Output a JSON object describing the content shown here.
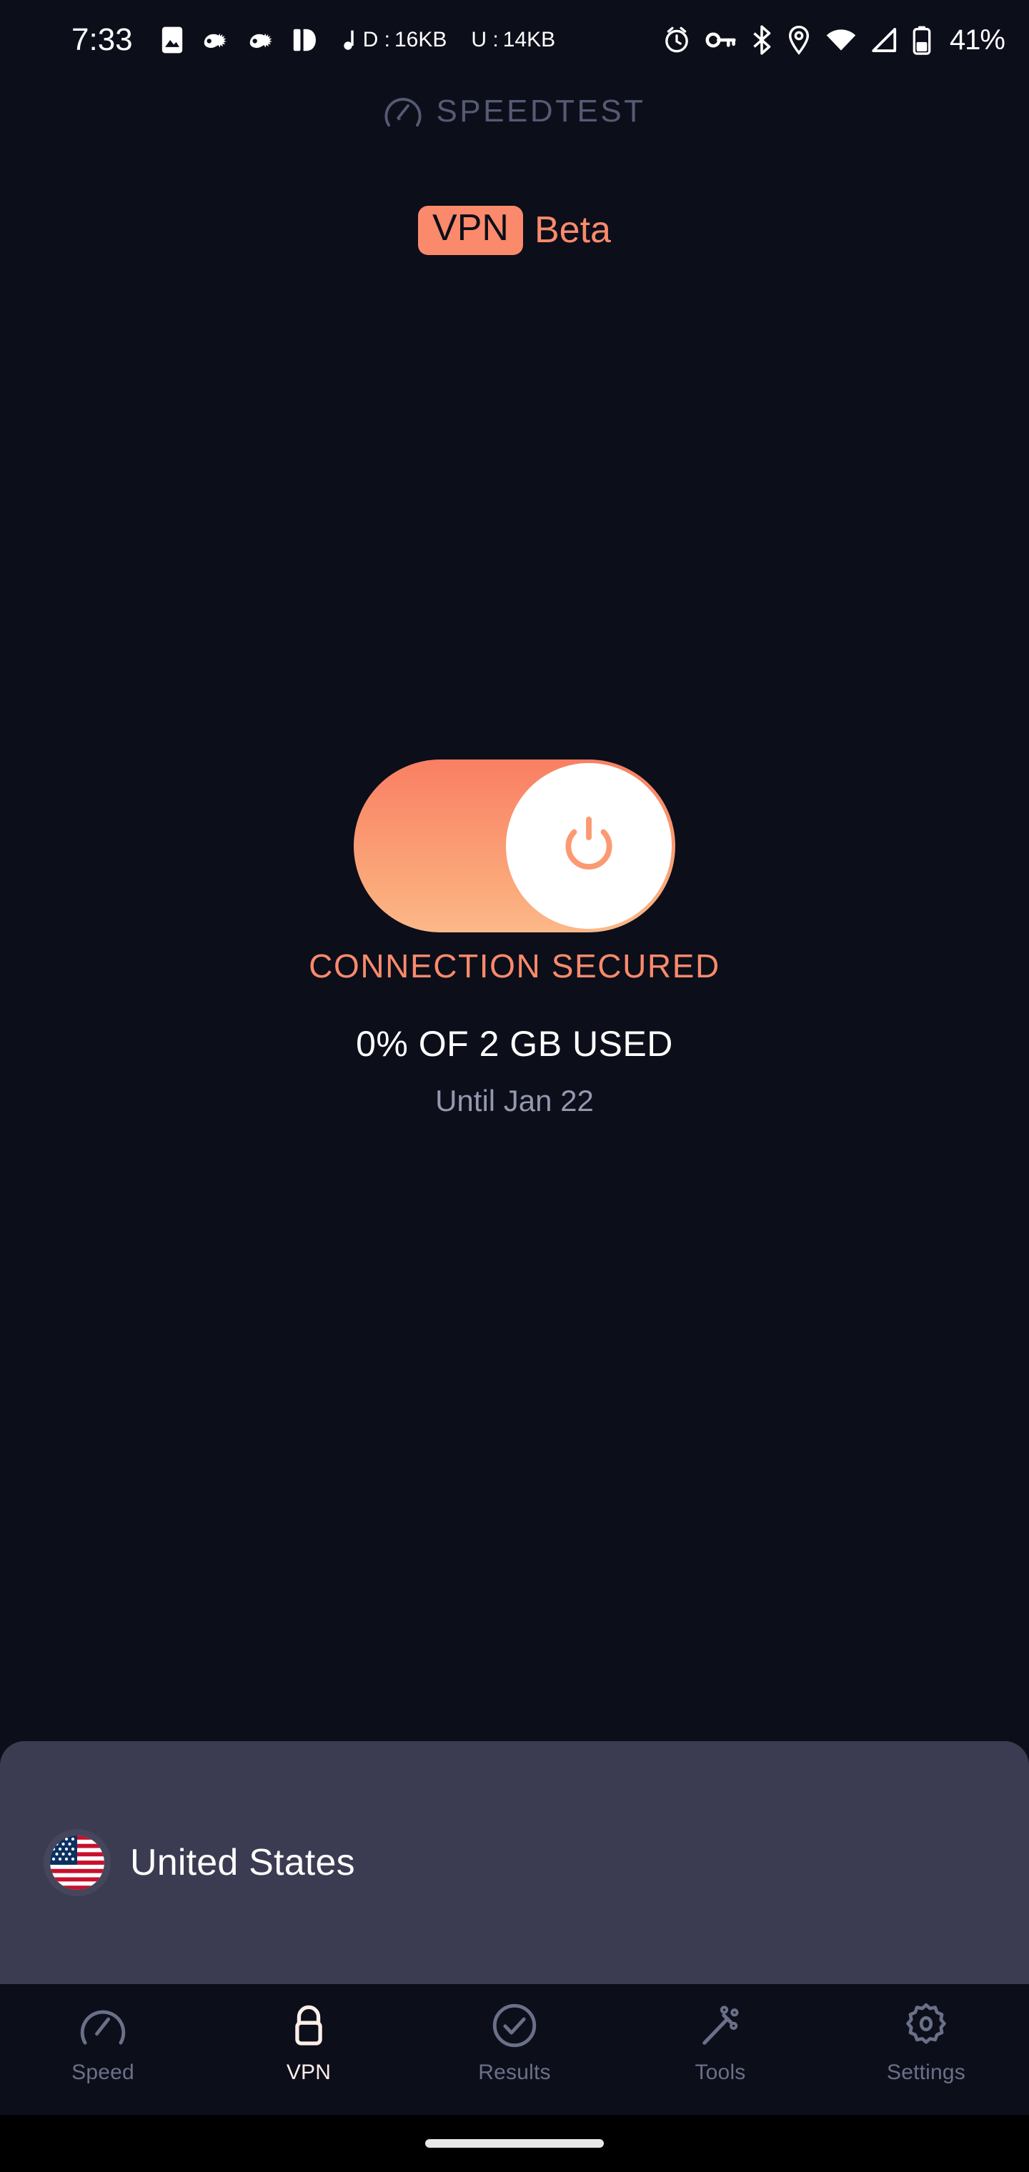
{
  "status_bar": {
    "time": "7:33",
    "left_icons": [
      "image-icon",
      "hedgehog-icon",
      "hedgehog-icon",
      "pushbullet-icon"
    ],
    "download": {
      "icon": "music-note-icon",
      "label": "D :",
      "value": "16KB"
    },
    "upload": {
      "label": "U :",
      "value": "14KB"
    },
    "right_icons": [
      "alarm-clock-icon",
      "vpn-key-icon",
      "bluetooth-icon",
      "location-pin-icon",
      "wifi-icon",
      "cellular-signal-icon",
      "battery-icon"
    ],
    "battery_percent": "41%"
  },
  "header": {
    "logo_icon": "speedometer-icon",
    "logo_text": "SPEEDTEST"
  },
  "title": {
    "badge": "VPN",
    "beta": "Beta"
  },
  "toggle": {
    "state": "on",
    "icon": "power-icon",
    "accent_top": "#f97f63",
    "accent_bottom": "#fcb88a",
    "knob_color": "#ffffff"
  },
  "status": {
    "connection": "CONNECTION SECURED",
    "connection_color": "#fa8a6b",
    "usage": "0% OF 2 GB USED",
    "until": "Until Jan 22"
  },
  "country": {
    "flag": "us-flag-icon",
    "name": "United States"
  },
  "bottom_nav": {
    "active_index": 1,
    "items": [
      {
        "label": "Speed",
        "icon": "speedometer-icon"
      },
      {
        "label": "VPN",
        "icon": "lock-icon"
      },
      {
        "label": "Results",
        "icon": "check-circle-icon"
      },
      {
        "label": "Tools",
        "icon": "magic-wand-icon"
      },
      {
        "label": "Settings",
        "icon": "gear-icon"
      }
    ]
  },
  "colors": {
    "background": "#0c0e1a",
    "panel": "#3b3c52",
    "accent": "#fa8a6b",
    "muted_text": "#6b7089"
  }
}
